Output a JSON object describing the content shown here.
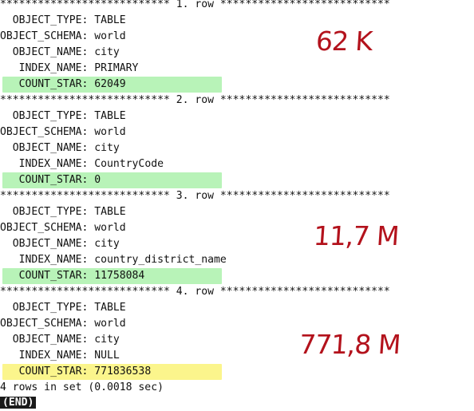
{
  "rows": [
    {
      "header": "*************************** 1. row ***************************",
      "fields": [
        {
          "label": "  OBJECT_TYPE: ",
          "value": "TABLE"
        },
        {
          "label": "OBJECT_SCHEMA: ",
          "value": "world"
        },
        {
          "label": "  OBJECT_NAME: ",
          "value": "city"
        },
        {
          "label": "   INDEX_NAME: ",
          "value": "PRIMARY"
        },
        {
          "label": "   COUNT_STAR: ",
          "value": "62049"
        }
      ],
      "highlight_color": "#b8f3b8",
      "annotation": "62 K"
    },
    {
      "header": "*************************** 2. row ***************************",
      "fields": [
        {
          "label": "  OBJECT_TYPE: ",
          "value": "TABLE"
        },
        {
          "label": "OBJECT_SCHEMA: ",
          "value": "world"
        },
        {
          "label": "  OBJECT_NAME: ",
          "value": "city"
        },
        {
          "label": "   INDEX_NAME: ",
          "value": "CountryCode"
        },
        {
          "label": "   COUNT_STAR: ",
          "value": "0"
        }
      ],
      "highlight_color": "#b8f3b8",
      "annotation": ""
    },
    {
      "header": "*************************** 3. row ***************************",
      "fields": [
        {
          "label": "  OBJECT_TYPE: ",
          "value": "TABLE"
        },
        {
          "label": "OBJECT_SCHEMA: ",
          "value": "world"
        },
        {
          "label": "  OBJECT_NAME: ",
          "value": "city"
        },
        {
          "label": "   INDEX_NAME: ",
          "value": "country_district_name"
        },
        {
          "label": "   COUNT_STAR: ",
          "value": "11758084"
        }
      ],
      "highlight_color": "#b8f3b8",
      "annotation": "11,7 M"
    },
    {
      "header": "*************************** 4. row ***************************",
      "fields": [
        {
          "label": "  OBJECT_TYPE: ",
          "value": "TABLE"
        },
        {
          "label": "OBJECT_SCHEMA: ",
          "value": "world"
        },
        {
          "label": "  OBJECT_NAME: ",
          "value": "city"
        },
        {
          "label": "   INDEX_NAME: ",
          "value": "NULL"
        },
        {
          "label": "   COUNT_STAR: ",
          "value": "771836538"
        }
      ],
      "highlight_color": "#fbf58c",
      "annotation": "771,8 M"
    }
  ],
  "summary": "4 rows in set (0.0018 sec)",
  "end_marker": "(END)",
  "annotation_color": "#b3121c"
}
